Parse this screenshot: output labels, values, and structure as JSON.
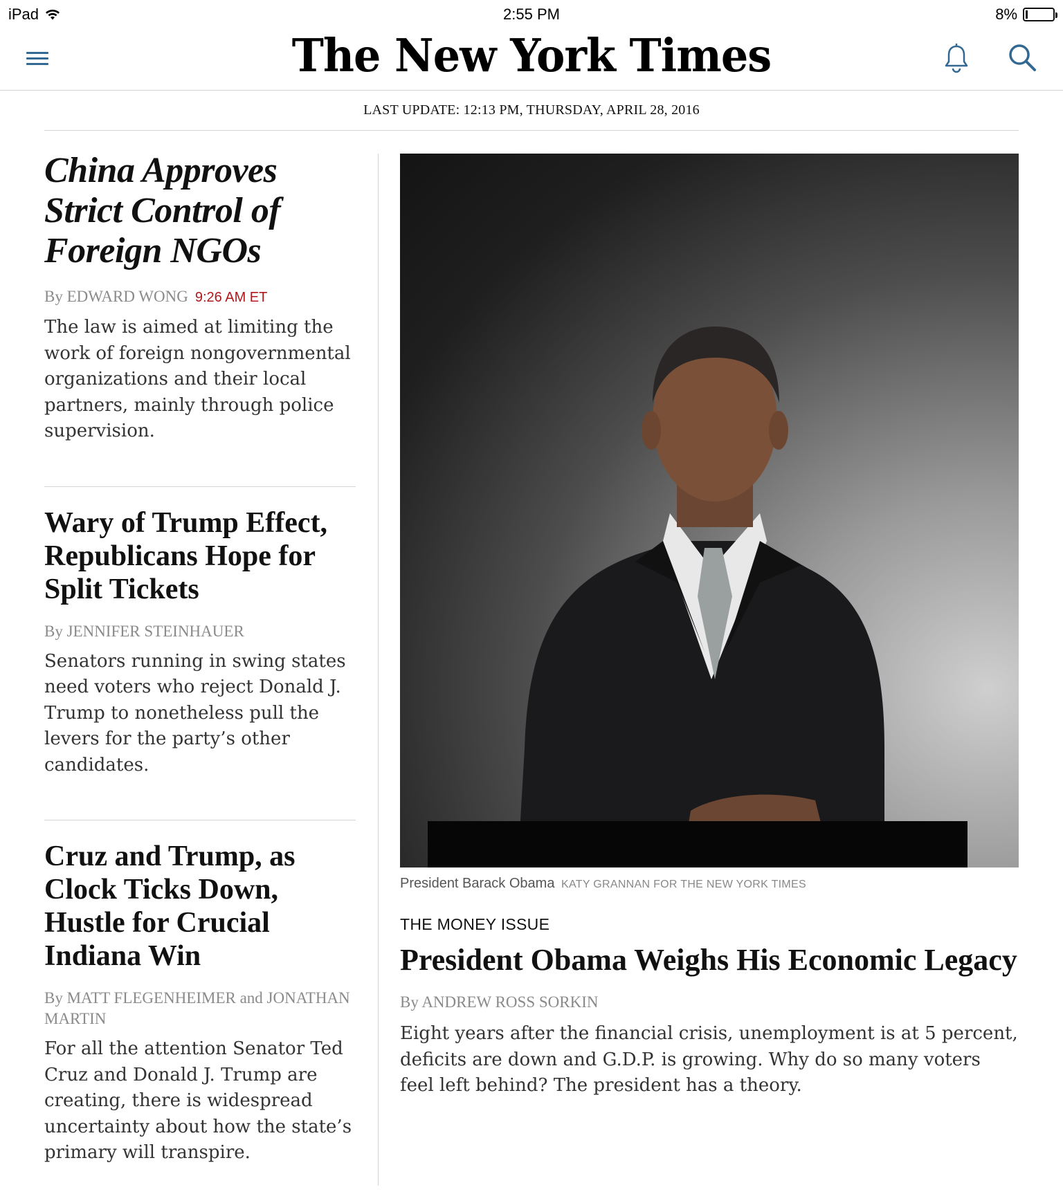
{
  "status_bar": {
    "device": "iPad",
    "time": "2:55 PM",
    "battery_percent_label": "8%",
    "battery_level": 0.08
  },
  "header": {
    "logo_text": "The New York Times",
    "accent_color": "#326891"
  },
  "last_update": "LAST UPDATE: 12:13 PM, THURSDAY, APRIL 28, 2016",
  "left_stories": [
    {
      "headline": "China Approves Strict Control of Foreign NGOs",
      "byline": "By EDWARD WONG",
      "time": "9:26 AM ET",
      "summary": "The law is aimed at limiting the work of foreign nongovernmental organizations and their local partners, mainly through police supervision."
    },
    {
      "headline": "Wary of Trump Effect, Republicans Hope for Split Tickets",
      "byline": "By JENNIFER STEINHAUER",
      "summary": "Senators running in swing states need voters who reject Donald J. Trump to nonetheless pull the levers for the party’s other candidates."
    },
    {
      "headline": "Cruz and Trump, as Clock Ticks Down, Hustle for Crucial Indiana Win",
      "byline": "By MATT FLEGENHEIMER and JONATHAN MARTIN",
      "summary": "For all the attention Senator Ted Cruz and Donald J. Trump are creating, there is widespread uncertainty about how the state’s primary will transpire."
    }
  ],
  "lead_story": {
    "photo_caption": "President Barack Obama",
    "photo_credit": "KATY GRANNAN FOR THE NEW YORK TIMES",
    "kicker": "THE MONEY ISSUE",
    "headline": "President Obama Weighs His Economic Legacy",
    "byline": "By ANDREW ROSS SORKIN",
    "summary": "Eight years after the financial crisis, unemployment is at 5 percent, deficits are down and G.D.P. is growing. Why do so many voters feel left behind? The president has a theory."
  }
}
